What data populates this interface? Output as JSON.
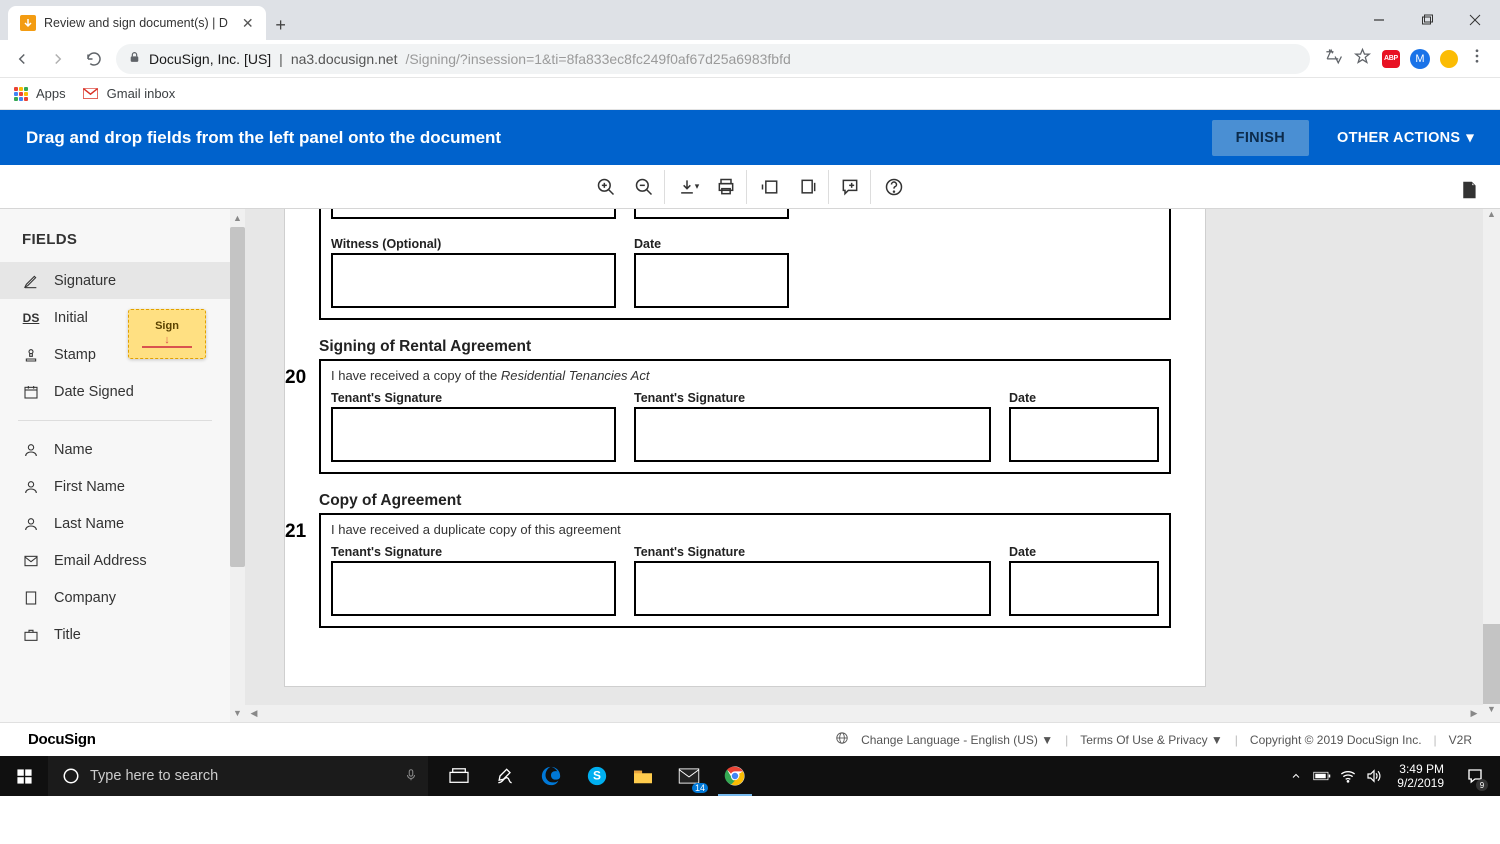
{
  "browser": {
    "tab_title": "Review and sign document(s) | D",
    "url_publisher": "DocuSign, Inc. [US]",
    "url_host": "na3.docusign.net",
    "url_path": "/Signing/?insession=1&ti=8fa833ec8fc249f0af67d25a6983fbfd",
    "bookmarks": {
      "apps": "Apps",
      "gmail": "Gmail inbox"
    }
  },
  "docusign": {
    "instruction": "Drag and drop fields from the left panel onto the document",
    "finish": "FINISH",
    "other_actions": "OTHER ACTIONS",
    "fields_header": "FIELDS",
    "fields_group1": [
      "Signature",
      "Initial",
      "Stamp",
      "Date Signed"
    ],
    "fields_group2": [
      "Name",
      "First Name",
      "Last Name",
      "Email Address",
      "Company",
      "Title"
    ],
    "sign_tag": "Sign",
    "footer": {
      "brand": "DocuSign",
      "lang": "Change Language - English (US)",
      "terms": "Terms Of Use & Privacy",
      "copyright": "Copyright © 2019 DocuSign Inc.",
      "ver": "V2R"
    }
  },
  "form": {
    "witness_label": "Witness (Optional)",
    "date_label": "Date",
    "sect20": {
      "num": "20",
      "title": "Signing of Rental Agreement",
      "desc_a": "I have received a copy of the ",
      "desc_em": "Residential Tenancies Act",
      "tsig": "Tenant's Signature"
    },
    "sect21": {
      "num": "21",
      "title": "Copy of Agreement",
      "desc": "I have received a duplicate copy of this agreement",
      "tsig": "Tenant's Signature"
    }
  },
  "taskbar": {
    "search_placeholder": "Type here to search",
    "time": "3:49 PM",
    "date": "9/2/2019",
    "mail_badge": "14",
    "notif_badge": "9"
  }
}
